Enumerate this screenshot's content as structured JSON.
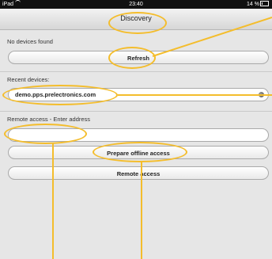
{
  "status": {
    "device": "iPad",
    "time": "23:40",
    "battery": "14 %"
  },
  "nav": {
    "title": "Discovery"
  },
  "discovery": {
    "no_devices_text": "No devices found",
    "refresh_label": "Refresh",
    "recent_devices_label": "Recent devices:",
    "recent_device": "demo.pps.prelectronics.com",
    "remote_label": "Remote access - Enter address",
    "address_value": "",
    "prepare_offline_label": "Prepare offline access",
    "remote_access_label": "Remote access"
  },
  "colors": {
    "annotation": "#f4bd2c",
    "background": "#e6e6e6"
  },
  "icons": [
    "wifi-icon",
    "battery-icon",
    "disclosure-dot-icon"
  ]
}
